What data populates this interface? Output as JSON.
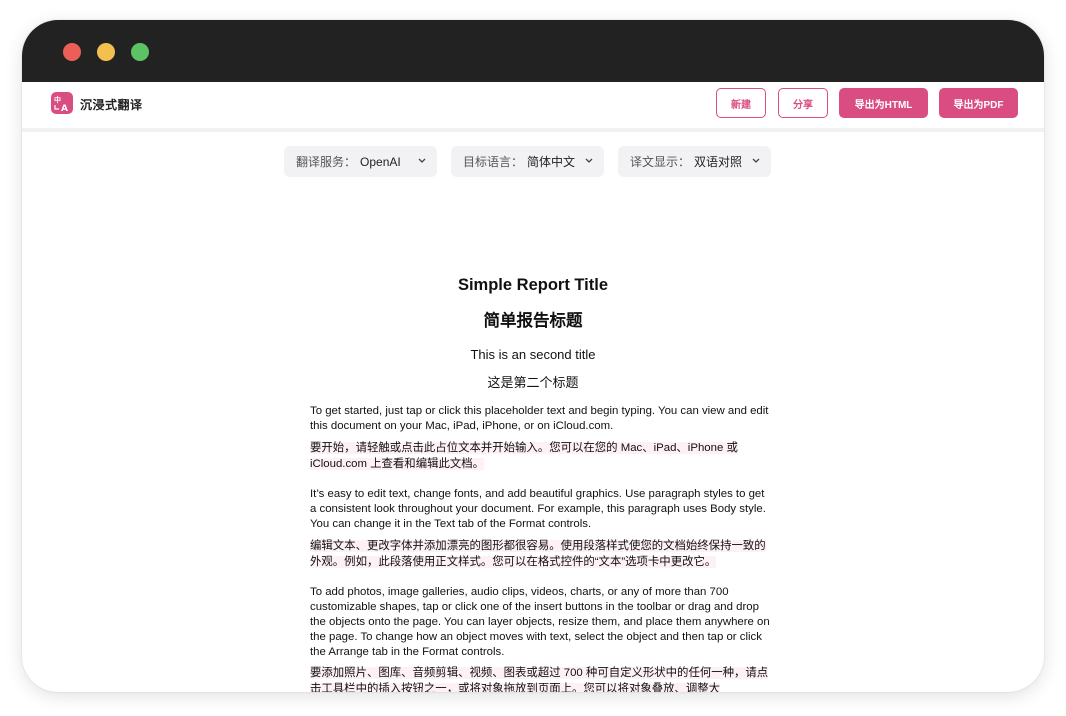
{
  "app": {
    "name": "沉浸式翻译"
  },
  "toolbar": {
    "new_label": "新建",
    "share_label": "分享",
    "export_html_label": "导出为HTML",
    "export_pdf_label": "导出为PDF"
  },
  "selectors": [
    {
      "label": "翻译服务：",
      "value": "OpenAI"
    },
    {
      "label": "目标语言：",
      "value": "简体中文"
    },
    {
      "label": "译文显示：",
      "value": "双语对照"
    }
  ],
  "document": {
    "title_en": "Simple Report Title",
    "title_zh": "简单报告标题",
    "subtitle_en": "This is an second title",
    "subtitle_zh": "这是第二个标题",
    "paragraphs": [
      {
        "en": "To get started, just tap or click this placeholder text and begin typing. You can view and edit this document on your Mac, iPad, iPhone, or on iCloud.com.",
        "zh": "要开始，请轻触或点击此占位文本并开始输入。您可以在您的 Mac、iPad、iPhone 或 iCloud.com 上查看和编辑此文档。"
      },
      {
        "en": "It’s easy to edit text, change fonts, and add beautiful graphics. Use paragraph styles to get a consistent look throughout your document. For example, this paragraph uses Body style. You can change it in the Text tab of the Format controls.",
        "zh": "编辑文本、更改字体并添加漂亮的图形都很容易。使用段落样式使您的文档始终保持一致的外观。例如，此段落使用正文样式。您可以在格式控件的“文本”选项卡中更改它。"
      },
      {
        "en": "To add photos, image galleries, audio clips, videos, charts, or any of more than 700 customizable shapes, tap or click one of the insert buttons in the toolbar or drag and drop the objects onto the page. You can layer objects, resize them, and place them anywhere on the page. To change how an object moves with text, select the object and then tap or click the Arrange tab in the Format controls.",
        "zh": "要添加照片、图库、音频剪辑、视频、图表或超过 700 种可自定义形状中的任何一种，请点击工具栏中的插入按钮之一，或将对象拖放到页面上。您可以将对象叠放、调整大"
      }
    ]
  },
  "colors": {
    "accent": "#d94d82",
    "titlebar": "#222222",
    "selector_bg": "#f2f2f4",
    "translation_highlight": "#fdf1f6"
  }
}
